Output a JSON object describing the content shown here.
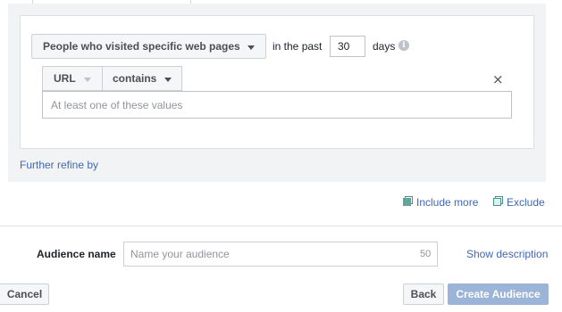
{
  "rule": {
    "source_dropdown": "People who visited specific web pages",
    "in_past_label": "in the past",
    "days_value": "30",
    "days_label": "days",
    "info_glyph": "i",
    "url_field_label": "URL",
    "operator_label": "contains",
    "remove_glyph": "×",
    "values_placeholder": "At least one of these values"
  },
  "refine_link": "Further refine by",
  "actions": {
    "include_more": "Include more",
    "exclude": "Exclude"
  },
  "audience": {
    "label": "Audience name",
    "placeholder": "Name your audience",
    "char_count": "50",
    "show_description": "Show description"
  },
  "footer": {
    "cancel": "Cancel",
    "back": "Back",
    "create": "Create Audience"
  },
  "colors": {
    "link": "#4267b2",
    "create_button_disabled": "#9cb4d8",
    "panel_background": "#f2f3f5"
  }
}
